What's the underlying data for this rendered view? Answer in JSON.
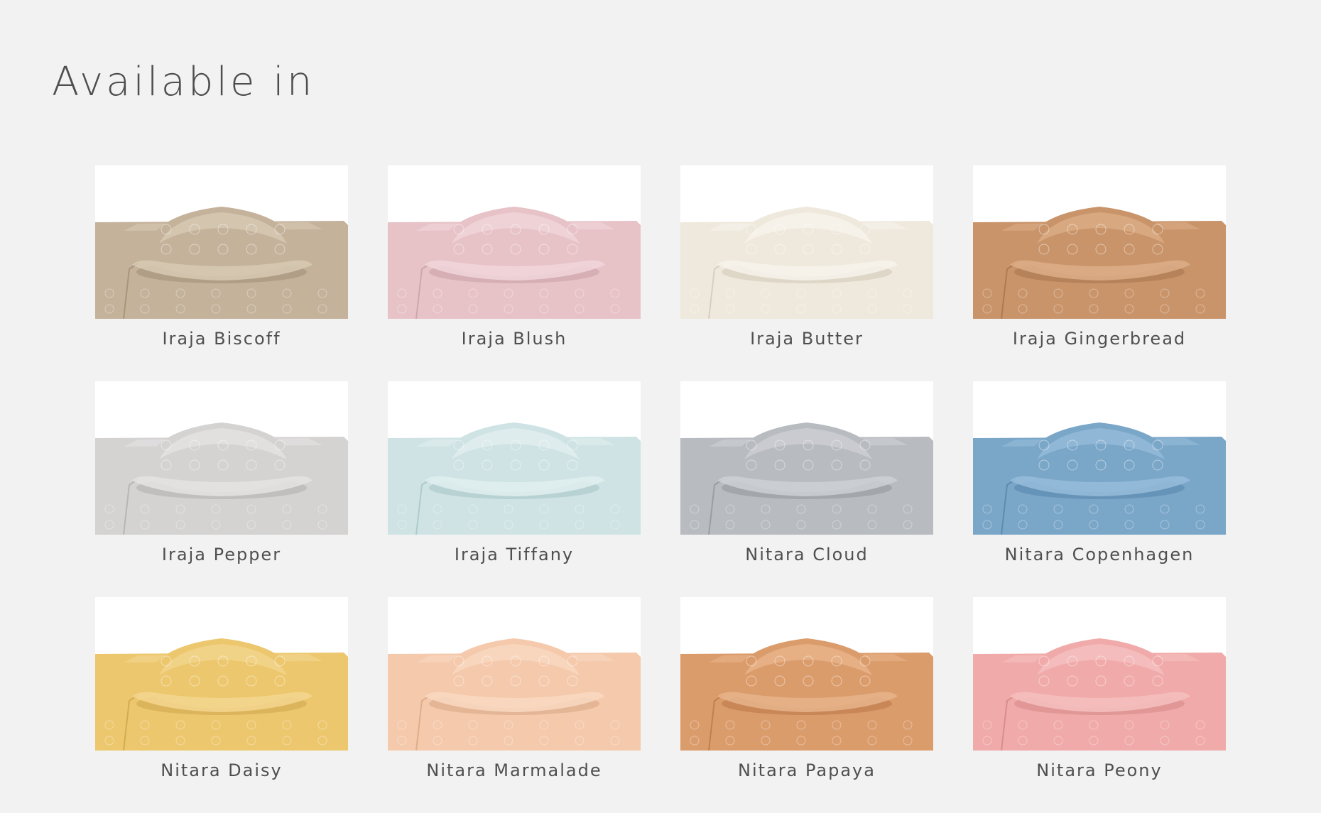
{
  "page": {
    "title": "Available in"
  },
  "products": [
    {
      "name": "Iraja Biscoff",
      "color": "#c4b29b",
      "shade": "#a8957d",
      "light": "#d8c9b4"
    },
    {
      "name": "Iraja Blush",
      "color": "#e7c3c8",
      "shade": "#cfa6ad",
      "light": "#f1d6da"
    },
    {
      "name": "Iraja Butter",
      "color": "#efe9dd",
      "shade": "#d7cfbe",
      "light": "#f7f3ec"
    },
    {
      "name": "Iraja Gingerbread",
      "color": "#c9946a",
      "shade": "#ad7a52",
      "light": "#dcae87"
    },
    {
      "name": "Iraja Pepper",
      "color": "#d4d3d2",
      "shade": "#b8b6b4",
      "light": "#e4e3e2"
    },
    {
      "name": "Iraja Tiffany",
      "color": "#cfe3e4",
      "shade": "#aecbcd",
      "light": "#e1eeef"
    },
    {
      "name": "Nitara Cloud",
      "color": "#b8bbc0",
      "shade": "#9a9ea4",
      "light": "#cdd0d4"
    },
    {
      "name": "Nitara Copenhagen",
      "color": "#7aa6c8",
      "shade": "#5e8bb0",
      "light": "#96bcd9"
    },
    {
      "name": "Nitara Daisy",
      "color": "#ecc76e",
      "shade": "#d4ac52",
      "light": "#f3d68f"
    },
    {
      "name": "Nitara Marmalade",
      "color": "#f5c9ab",
      "shade": "#deae8d",
      "light": "#f9d9c2"
    },
    {
      "name": "Nitara Papaya",
      "color": "#db9c6c",
      "shade": "#c27f50",
      "light": "#e8b48b"
    },
    {
      "name": "Nitara Peony",
      "color": "#f0aaa9",
      "shade": "#d98e8d",
      "light": "#f5c1c0"
    }
  ]
}
